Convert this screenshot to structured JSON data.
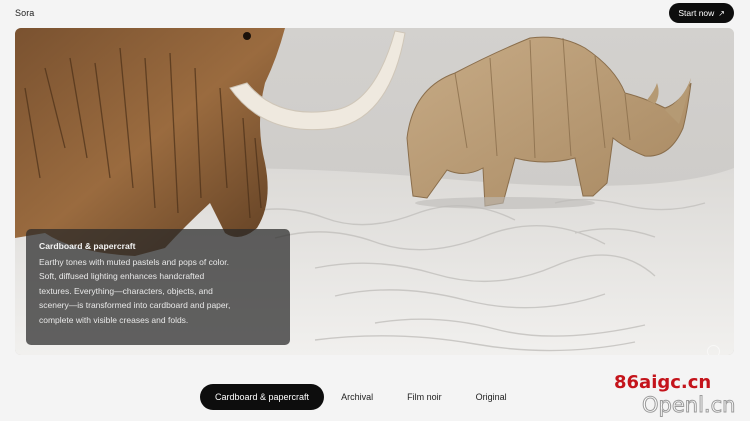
{
  "header": {
    "brand": "Sora",
    "cta_label": "Start now",
    "cta_icon": "arrow-up-right-icon"
  },
  "hero": {
    "image_subject": "origami mammoth and cardboard rhinoceros on white paper terrain",
    "caption": {
      "title": "Cardboard & papercraft",
      "lines": [
        "Earthy tones with muted pastels and pops of color.",
        "Soft, diffused lighting enhances handcrafted",
        "textures. Everything—characters, objects, and",
        "scenery—is transformed into cardboard and paper,",
        "complete with visible creases and folds."
      ]
    }
  },
  "style_tabs": {
    "items": [
      {
        "label": "Cardboard & papercraft",
        "active": true
      },
      {
        "label": "Archival",
        "active": false
      },
      {
        "label": "Film noir",
        "active": false
      },
      {
        "label": "Original",
        "active": false
      }
    ]
  },
  "watermark": {
    "line1": "86aigc.cn",
    "line2": "Openl.cn"
  },
  "colors": {
    "accent": "#0d0d0d",
    "background": "#f4f4f4",
    "watermark_red": "#c4141b"
  }
}
